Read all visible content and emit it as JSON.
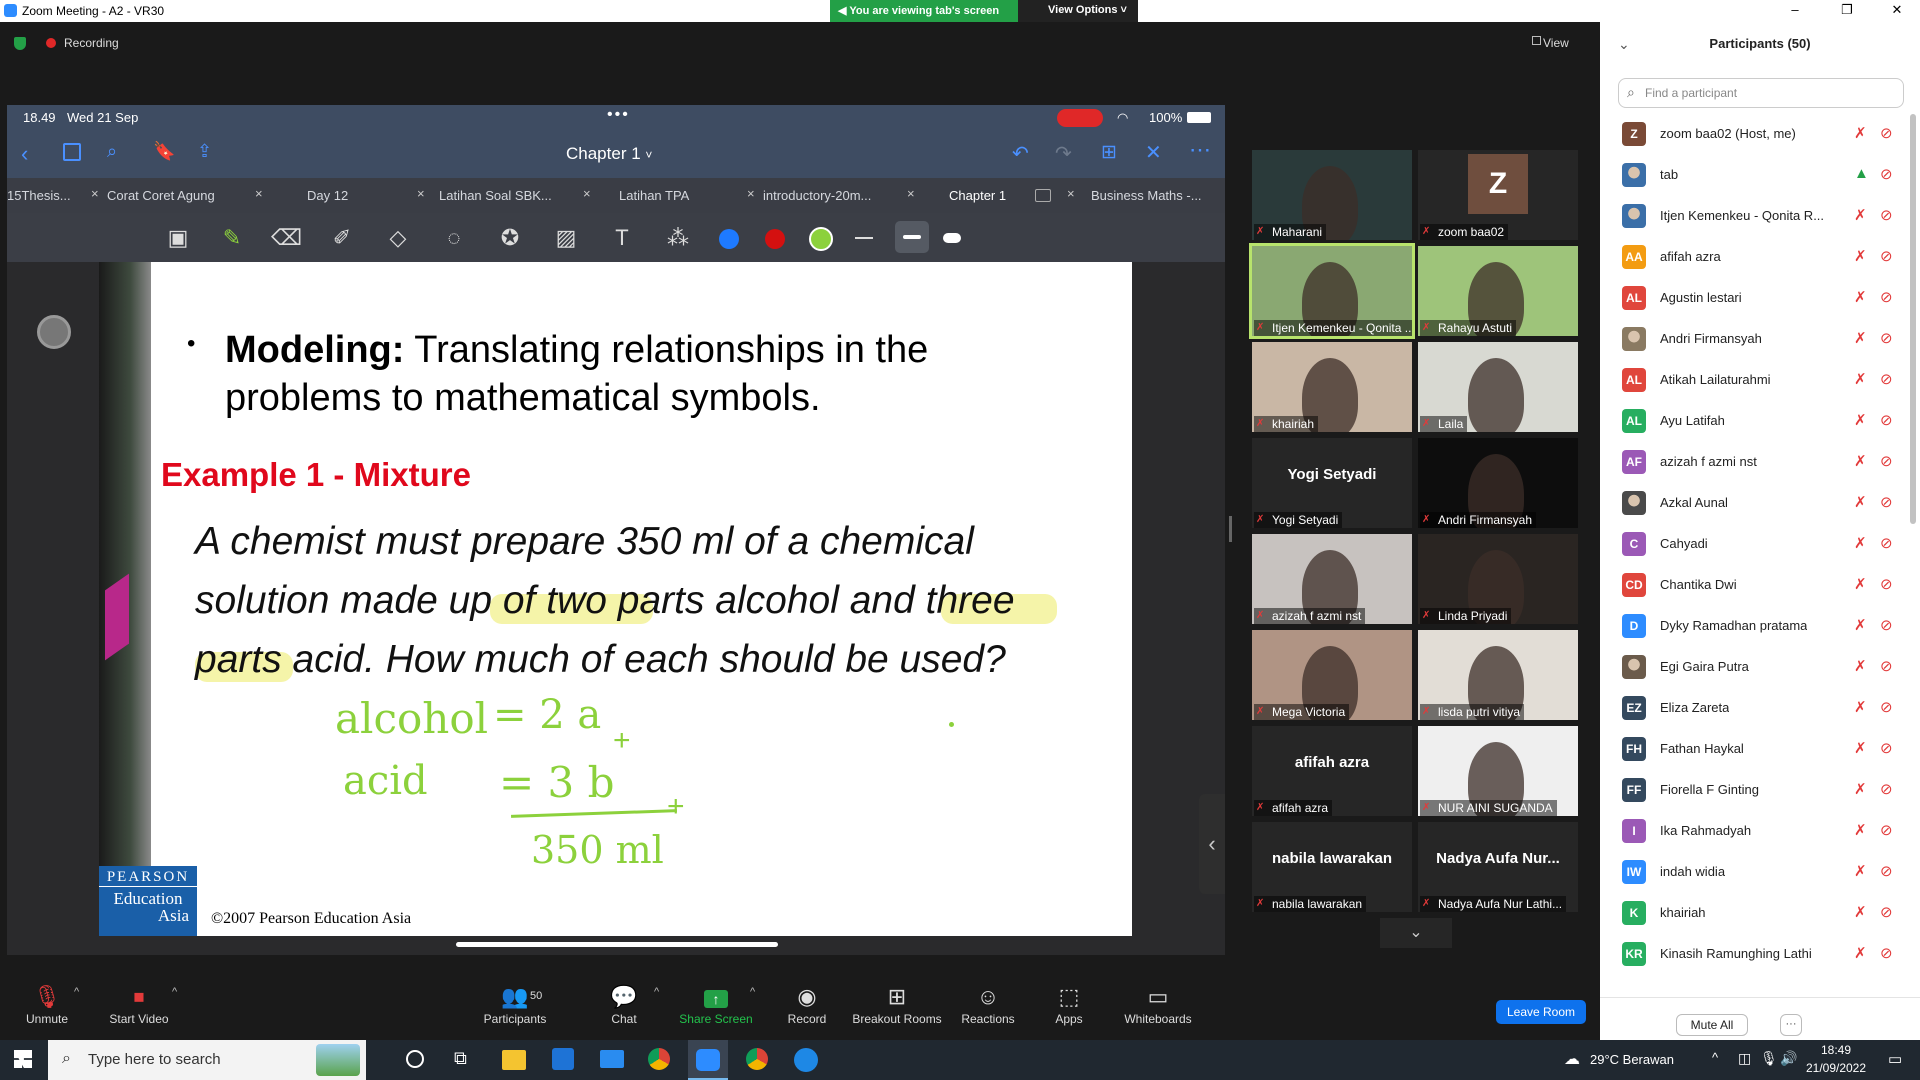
{
  "window": {
    "title": "Zoom Meeting - A2 - VR30",
    "controls": [
      "–",
      "❐",
      "✕"
    ]
  },
  "share_banner": {
    "viewing": "You are viewing tab's screen",
    "view_options": "View Options"
  },
  "recording": "Recording",
  "view_label": "View",
  "ipad": {
    "time": "18.49",
    "date": "Wed 21 Sep",
    "battery": "100%",
    "doc_title": "Chapter 1",
    "tabs": [
      {
        "label": "15Thesis..."
      },
      {
        "label": "Corat Coret Agung"
      },
      {
        "label": "Day 12"
      },
      {
        "label": "Latihan Soal SBK..."
      },
      {
        "label": "Latihan TPA"
      },
      {
        "label": "introductory-20m..."
      },
      {
        "label": "Chapter 1"
      },
      {
        "label": "Business Maths -..."
      }
    ]
  },
  "slide": {
    "bullet_bold": "Modeling:",
    "bullet_text": " Translating relationships in the problems to mathematical symbols.",
    "example_title": "Example 1 - Mixture",
    "problem_line1": "A chemist must prepare 350 ml of a chemical",
    "problem_line2": "solution made up of two parts alcohol and three",
    "problem_line3": "parts acid. How much of each should be used?",
    "hw1": "alcohol",
    "hw2": "= 2 a",
    "hw3": "acid",
    "hw4": "= 3 b",
    "hw5": "350 ml",
    "publisher_line1": "PEARSON",
    "publisher_line2": "Education",
    "publisher_line3": "Asia",
    "copyright": "©2007 Pearson Education Asia"
  },
  "gallery": [
    {
      "name": "Maharani",
      "type": "video",
      "bg": "#2a3a3a"
    },
    {
      "name": "zoom baa02",
      "type": "avatar",
      "letter": "Z"
    },
    {
      "name": "Itjen Kemenkeu - Qonita ...",
      "type": "video",
      "bg": "#8aa872",
      "active": true
    },
    {
      "name": "Rahayu Astuti",
      "type": "video",
      "bg": "#9ec47a"
    },
    {
      "name": "khairiah",
      "type": "video",
      "bg": "#c9b7a5"
    },
    {
      "name": "Laila",
      "type": "video",
      "bg": "#d8d9d2"
    },
    {
      "name": "Yogi Setyadi",
      "type": "text",
      "big": "Yogi Setyadi"
    },
    {
      "name": "Andri Firmansyah",
      "type": "video",
      "bg": "#0d0d0d"
    },
    {
      "name": "azizah f azmi nst",
      "type": "video",
      "bg": "#c7c2bf"
    },
    {
      "name": "Linda Priyadi",
      "type": "video",
      "bg": "#2a2522"
    },
    {
      "name": "Mega Victoria",
      "type": "video",
      "bg": "#b09484"
    },
    {
      "name": "lisda putri vitiya",
      "type": "video",
      "bg": "#e2ddd6"
    },
    {
      "name": "afifah azra",
      "type": "text",
      "big": "afifah azra"
    },
    {
      "name": "NUR AINI SUGANDA",
      "type": "video",
      "bg": "#efefef"
    },
    {
      "name": "nabila lawarakan",
      "type": "text",
      "big": "nabila lawarakan"
    },
    {
      "name": "Nadya Aufa Nur Lathi...",
      "type": "text",
      "big": "Nadya Aufa Nur..."
    }
  ],
  "panel": {
    "title": "Participants (50)",
    "search_placeholder": "Find a participant",
    "mute_all": "Mute All",
    "more": "···",
    "participants": [
      {
        "initials": "Z",
        "name": "zoom baa02 (Host, me)",
        "color": "#7a4a36"
      },
      {
        "initials": "",
        "name": "tab",
        "color": "#3b6fa8",
        "photo": true
      },
      {
        "initials": "",
        "name": "Itjen Kemenkeu - Qonita R...",
        "color": "#3b6fa8",
        "photo": true
      },
      {
        "initials": "AA",
        "name": "afifah azra",
        "color": "#f39c12"
      },
      {
        "initials": "AL",
        "name": "Agustin lestari",
        "color": "#e0463c"
      },
      {
        "initials": "",
        "name": "Andri Firmansyah",
        "color": "#8a7a62",
        "photo": true
      },
      {
        "initials": "AL",
        "name": "Atikah Lailaturahmi",
        "color": "#e0463c"
      },
      {
        "initials": "AL",
        "name": "Ayu Latifah",
        "color": "#27ae60"
      },
      {
        "initials": "AF",
        "name": "azizah f azmi nst",
        "color": "#9b59b6"
      },
      {
        "initials": "",
        "name": "Azkal Aunal",
        "color": "#4a4a4a",
        "photo": true
      },
      {
        "initials": "C",
        "name": "Cahyadi",
        "color": "#9b59b6"
      },
      {
        "initials": "CD",
        "name": "Chantika Dwi",
        "color": "#e0463c"
      },
      {
        "initials": "D",
        "name": "Dyky Ramadhan pratama",
        "color": "#2d8cff"
      },
      {
        "initials": "",
        "name": "Egi Gaira Putra",
        "color": "#6b5b4b",
        "photo": true
      },
      {
        "initials": "EZ",
        "name": "Eliza Zareta",
        "color": "#34495e"
      },
      {
        "initials": "FH",
        "name": "Fathan Haykal",
        "color": "#34495e"
      },
      {
        "initials": "FF",
        "name": "Fiorella F Ginting",
        "color": "#34495e"
      },
      {
        "initials": "I",
        "name": "Ika Rahmadyah",
        "color": "#9b59b6"
      },
      {
        "initials": "IW",
        "name": "indah widia",
        "color": "#2d8cff"
      },
      {
        "initials": "K",
        "name": "khairiah",
        "color": "#27ae60"
      },
      {
        "initials": "KR",
        "name": "Kinasih Ramunghing Lathi",
        "color": "#27ae60"
      }
    ]
  },
  "toolbar": {
    "unmute": "Unmute",
    "start_video": "Start Video",
    "participants": "Participants",
    "participants_count": "50",
    "chat": "Chat",
    "share_screen": "Share Screen",
    "record": "Record",
    "breakout": "Breakout Rooms",
    "reactions": "Reactions",
    "apps": "Apps",
    "whiteboards": "Whiteboards",
    "leave": "Leave Room"
  },
  "taskbar": {
    "search": "Type here to search",
    "weather": "29°C  Berawan",
    "time": "18:49",
    "date": "21/09/2022"
  },
  "colors": {
    "accent": "#2d8cff",
    "green": "#23a047",
    "red": "#e23a3a",
    "handwriting": "#8cd13c",
    "slide_red": "#e0081c"
  }
}
